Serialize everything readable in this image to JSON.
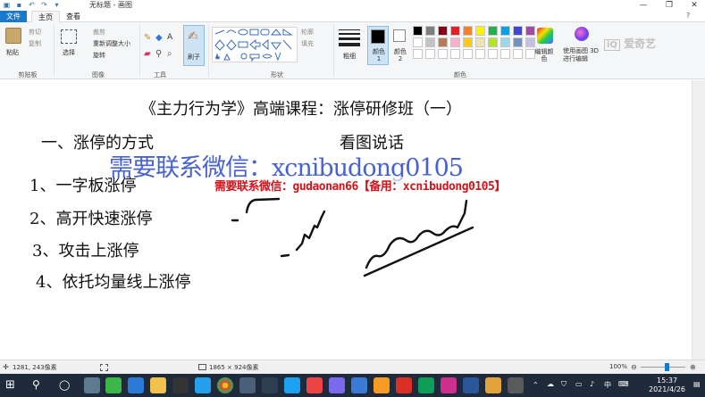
{
  "titlebar": {
    "title": "无标题 - 画图",
    "minimize": "—",
    "maximize": "❐",
    "close": "✕"
  },
  "tabs": [
    "文件",
    "主页",
    "查看"
  ],
  "ribbon": {
    "clipboard": {
      "paste": "粘贴",
      "cut": "剪切",
      "copy": "复制",
      "label": "剪贴板"
    },
    "image": {
      "select": "选择",
      "crop": "裁剪",
      "resize": "重新调整大小",
      "rotate": "旋转",
      "label": "图像"
    },
    "tools": {
      "label": "工具",
      "brushes": "刷子"
    },
    "shapes": {
      "outline": "轮廓",
      "fill": "填充",
      "label": "形状"
    },
    "size": {
      "label": "粗细"
    },
    "colors": {
      "color1": "颜色 1",
      "color2": "颜色 2",
      "edit": "编辑颜色",
      "paint3d": "使用画图 3D 进行编辑",
      "label": "颜色",
      "palette": [
        "#000000",
        "#7f7f7f",
        "#880015",
        "#ed1c24",
        "#ff7f27",
        "#fff200",
        "#22b14c",
        "#00a2e8",
        "#3f48cc",
        "#a349a4",
        "#ffffff",
        "#c3c3c3",
        "#b97a57",
        "#ffaec9",
        "#ffc90e",
        "#efe4b0",
        "#b5e61d",
        "#99d9ea",
        "#7092be",
        "#c8bfe7"
      ]
    },
    "watermark": "爱奇艺"
  },
  "canvas": {
    "heading": "《主力行为学》高端课程：涨停研修班（一）",
    "section": "一、涨停的方式",
    "subtitle": "看图说话",
    "items": [
      "1、一字板涨停",
      "2、高开快速涨停",
      "3、攻击上涨停",
      "4、依托均量线上涨停"
    ],
    "overlay_blue": "需要联系微信：xcnibudong0105",
    "overlay_red": "需要联系微信：gudaonan66【备用：xcnibudong0105】"
  },
  "statusbar": {
    "position": "1281, 243像素",
    "dimensions": "1865 × 924像素",
    "zoom": "100%"
  },
  "taskbar": {
    "time": "15:37",
    "date": "2021/4/26",
    "ime": "中"
  }
}
